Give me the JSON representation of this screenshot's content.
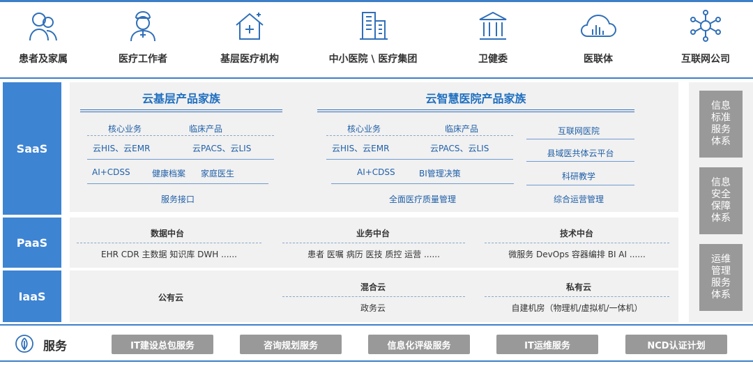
{
  "audiences": [
    {
      "label": "患者及家属",
      "icon": "patients-family-icon"
    },
    {
      "label": "医疗工作者",
      "icon": "doctor-icon"
    },
    {
      "label": "基层医疗机构",
      "icon": "clinic-house-icon"
    },
    {
      "label": "中小医院 \\ 医疗集团",
      "icon": "hospital-building-icon"
    },
    {
      "label": "卫健委",
      "icon": "government-building-icon"
    },
    {
      "label": "医联体",
      "icon": "cloud-data-icon"
    },
    {
      "label": "互联网公司",
      "icon": "network-node-icon"
    }
  ],
  "layers": {
    "saas": "SaaS",
    "paas": "PaaS",
    "iaas": "IaaS"
  },
  "saas": {
    "family1": {
      "title": "云基层产品家族",
      "core": "核心业务",
      "clinical": "临床产品",
      "core_items": "云HIS、云EMR",
      "clinical_items": "云PACS、云LIS",
      "ai": "AI+CDSS",
      "health": "健康档案",
      "family_doc": "家庭医生",
      "api": "服务接口"
    },
    "family2": {
      "title": "云智慧医院产品家族",
      "core": "核心业务",
      "clinical": "临床产品",
      "core_items": "云HIS、云EMR",
      "clinical_items": "云PACS、云LIS",
      "ai": "AI+CDSS",
      "bi": "BI管理决策",
      "quality": "全面医疗质量管理",
      "internet_hospital": "互联网医院",
      "county": "县域医共体云平台",
      "research": "科研教学",
      "ops": "综合运营管理"
    }
  },
  "paas": {
    "data": {
      "title": "数据中台",
      "items": "EHR  CDR  主数据  知识库  DWH  ......"
    },
    "business": {
      "title": "业务中台",
      "items": "患者  医嘱  病历  医技  质控  运营  ......"
    },
    "tech": {
      "title": "技术中台",
      "items": "微服务  DevOps  容器编排  BI  AI  ......"
    }
  },
  "iaas": {
    "public": "公有云",
    "hybrid": "混合云",
    "gov": "政务云",
    "private": "私有云",
    "private_items": "自建机房（物理机/虚拟机/一体机）"
  },
  "side_boxes": [
    "信息\n标准\n服务\n体系",
    "信息\n安全\n保障\n体系",
    "运维\n管理\n服务\n体系"
  ],
  "services": {
    "label": "服务",
    "icon": "leaf-icon",
    "items": [
      "IT建设总包服务",
      "咨询规划服务",
      "信息化评级服务",
      "IT运维服务",
      "NCD认证计划"
    ]
  },
  "colors": {
    "accent": "#3d84d3",
    "panel": "#f1f1f1",
    "title_blue": "#1f6fc0",
    "side_gray": "#999999"
  }
}
